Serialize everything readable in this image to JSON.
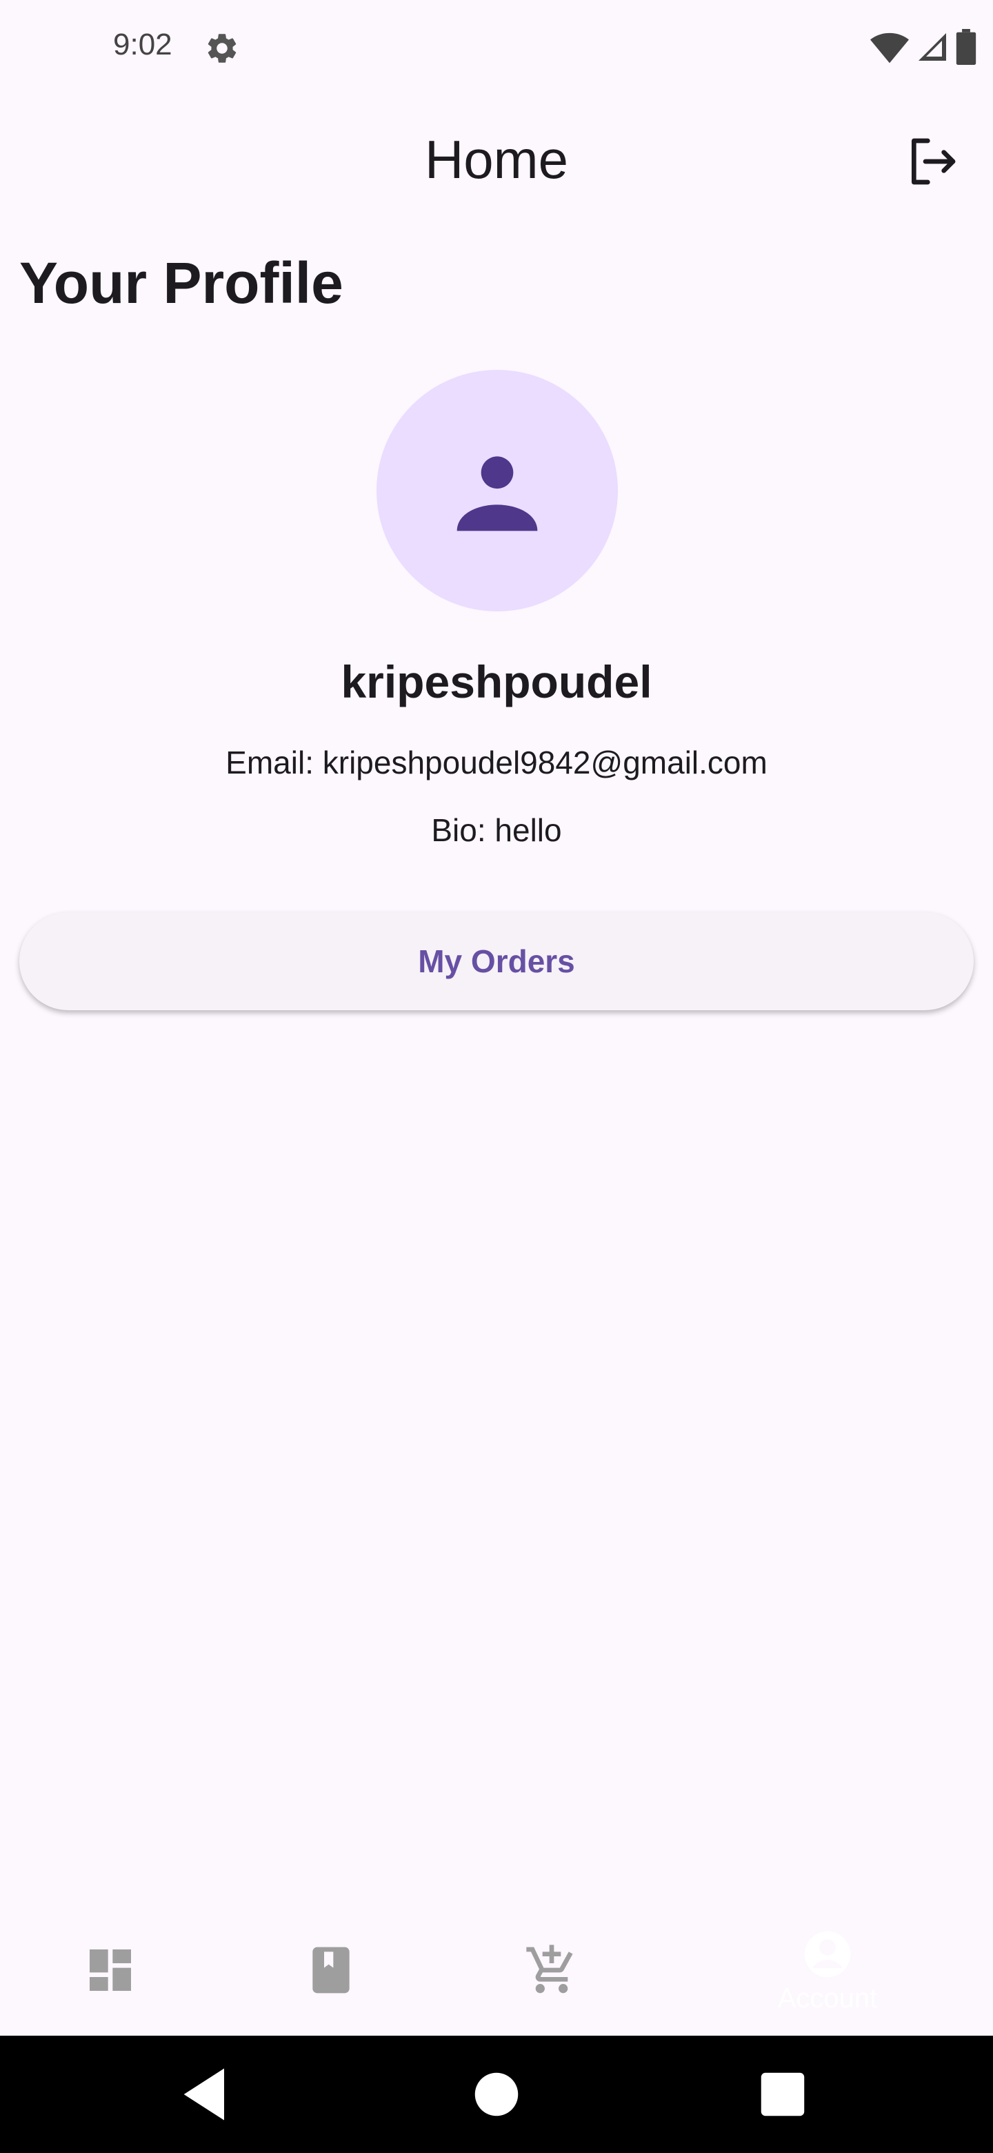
{
  "status_bar": {
    "time": "9:02",
    "icons": [
      "gear-icon",
      "wifi-icon",
      "signal-icon",
      "battery-icon"
    ]
  },
  "app_bar": {
    "title": "Home",
    "logout_icon": "logout-icon"
  },
  "profile": {
    "section_title": "Your Profile",
    "avatar_icon": "person-icon",
    "username": "kripeshpoudel",
    "email": "Email: kripeshpoudel9842@gmail.com",
    "bio": "Bio: hello",
    "orders_button": "My Orders"
  },
  "bottom_nav": {
    "items": [
      {
        "icon": "dashboard-icon"
      },
      {
        "icon": "book-icon"
      },
      {
        "icon": "add-cart-icon"
      },
      {
        "icon": "account-icon",
        "label": "Account",
        "selected": true
      }
    ]
  },
  "system_nav": {
    "icons": [
      "back-icon",
      "home-icon",
      "recents-icon"
    ]
  },
  "colors": {
    "background": "#fdf7fe",
    "accent": "#6750a4",
    "avatar_bg": "#eaddff",
    "avatar_fg": "#4f378b"
  }
}
